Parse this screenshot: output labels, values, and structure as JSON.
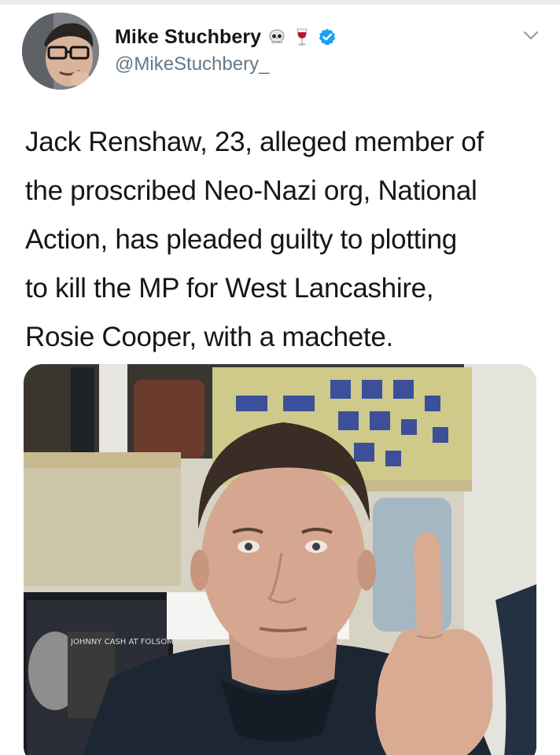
{
  "tweet": {
    "display_name": "Mike Stuchbery",
    "handle": "@MikeStuchbery_",
    "name_emojis": [
      "skull-icon",
      "wine-glass-icon"
    ],
    "verified_icon": "verified-badge-icon",
    "menu_icon": "chevron-down-icon",
    "text_lines": [
      "Jack Renshaw, 23, alleged member of",
      "the proscribed Neo-Nazi org, National",
      "Action, has pleaded guilty to plotting",
      "to kill the MP for West Lancashire,",
      "Rosie Cooper, with a machete."
    ],
    "media": {
      "kind": "photo",
      "poster_text": "JOHNNY CASH AT FOLSOM PRISON"
    }
  },
  "colors": {
    "verified": "#1da1f2",
    "secondary_text": "#657786",
    "primary_text": "#14171a",
    "divider": "#e9ebee"
  }
}
